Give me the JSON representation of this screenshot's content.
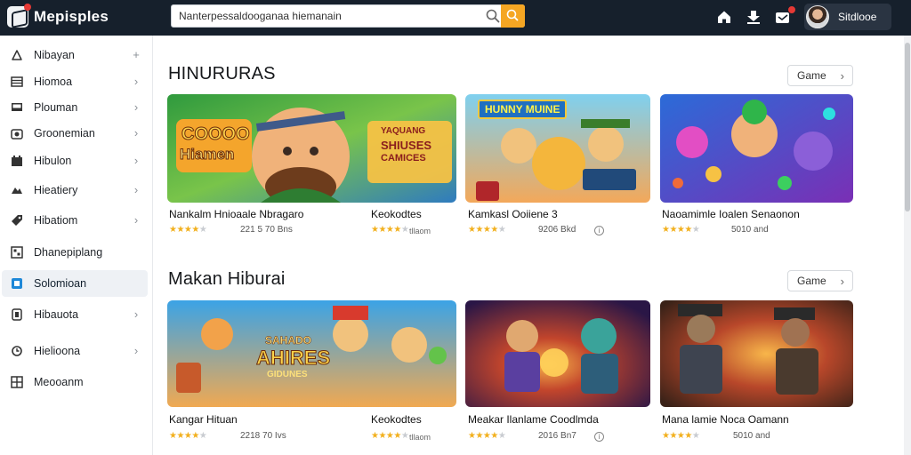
{
  "header": {
    "logo_text": "Mepisples",
    "search_value": "Nanterpessaldooganaa hiemanain",
    "user_name": "Sitdlooe",
    "colors": {
      "bar": "#16202c",
      "accent": "#f5a623",
      "badge": "#e53935"
    },
    "icons": [
      "home-icon",
      "download-icon",
      "notification-icon"
    ]
  },
  "sidebar": {
    "items": [
      {
        "label": "Nibayan",
        "icon": "bell-icon",
        "trail": "+"
      },
      {
        "label": "Hiomoa",
        "icon": "list-icon",
        "trail": "›"
      },
      {
        "label": "Plouman",
        "icon": "monitor-icon",
        "trail": "›"
      },
      {
        "label": "Groonemian",
        "icon": "camera-icon",
        "trail": "›"
      },
      {
        "label": "Hibulon",
        "icon": "calendar-icon",
        "trail": "›"
      },
      {
        "label": "Hieatiery",
        "icon": "puzzle-icon",
        "trail": "›"
      },
      {
        "label": "Hibatiom",
        "icon": "tag-icon",
        "trail": "›"
      },
      {
        "label": "Dhanepiplang",
        "icon": "grid-icon",
        "trail": ""
      },
      {
        "label": "Solomioan",
        "icon": "square-icon",
        "trail": "",
        "active": true
      },
      {
        "label": "Hibauota",
        "icon": "shield-icon",
        "trail": "›"
      },
      {
        "label": "Hielioona",
        "icon": "refresh-icon",
        "trail": "›"
      },
      {
        "label": "Meooanm",
        "icon": "window-icon",
        "trail": ""
      }
    ]
  },
  "sections": [
    {
      "title": "HINURURAS",
      "button": "Game",
      "cards": [
        {
          "title": "Nankalm Hnioaale Nbragaro",
          "rating": 4,
          "meta": "221 5 70 Bns",
          "sub": "Keokodtes",
          "sub_meta": "tllaom",
          "thumb_text_1": "COOOO",
          "thumb_text_2": "Hiamen",
          "thumb_text_3": "YAQUANG",
          "thumb_text_4": "SHIUSES",
          "thumb_text_5": "CAMICES"
        },
        {
          "title": "Kamkasl Ooiiene 3",
          "rating": 4,
          "meta": "9206 Bkd",
          "thumb_text_1": "HUNNY MUINE"
        },
        {
          "title": "Naoamimle Ioalen Senaonon",
          "rating": 4,
          "meta": "5010 and"
        }
      ]
    },
    {
      "title": "Makan Hiburai",
      "button": "Game",
      "cards": [
        {
          "title": "Kangar Hituan",
          "rating": 4,
          "meta": "2218 70 Ivs",
          "sub": "Keokodtes",
          "sub_meta": "tllaom",
          "thumb_text_1": "SAHADO",
          "thumb_text_2": "AHIRES",
          "thumb_text_3": "GIDUNES"
        },
        {
          "title": "Meakar Ilanlame Coodlmda",
          "rating": 4,
          "meta": "2016 Bn7"
        },
        {
          "title": "Mana lamie Noca Oamann",
          "rating": 4,
          "meta": "5010 and"
        }
      ]
    }
  ]
}
